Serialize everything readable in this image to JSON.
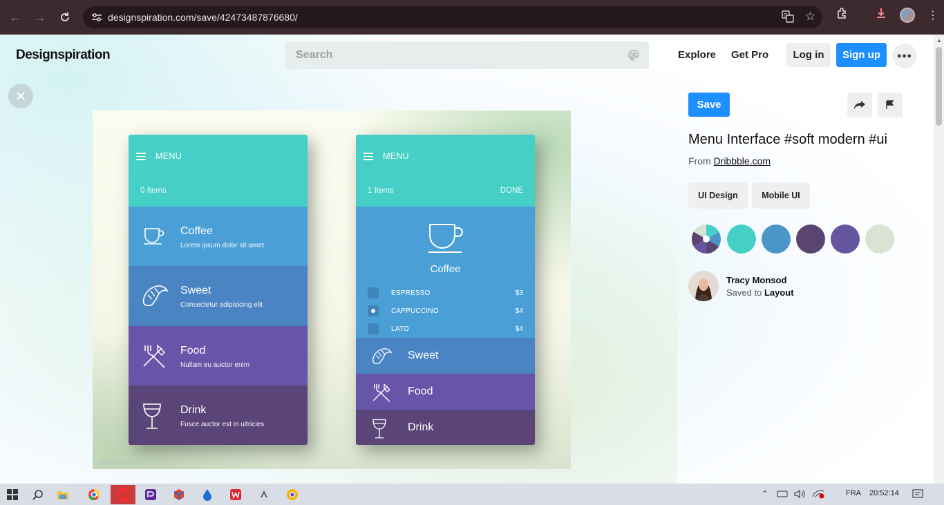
{
  "browser": {
    "url": "designspiration.com/save/42473487876680/"
  },
  "site": {
    "brand": "Designspiration",
    "search_placeholder": "Search",
    "nav": {
      "explore": "Explore",
      "get_pro": "Get Pro"
    },
    "login": "Log in",
    "signup": "Sign up",
    "more": "•••"
  },
  "artwork": {
    "credit": "dribbble.com/galshir",
    "left_phone": {
      "menu": "MENU",
      "count": "0 Items",
      "categories": [
        {
          "title": "Coffee",
          "subtitle": "Lorem ipsum dolor sit amet"
        },
        {
          "title": "Sweet",
          "subtitle": "Consectetur adipisicing elit"
        },
        {
          "title": "Food",
          "subtitle": "Nullam eu auctor enim"
        },
        {
          "title": "Drink",
          "subtitle": "Fusce auctor est in ultricies"
        }
      ]
    },
    "right_phone": {
      "menu": "MENU",
      "count": "1 Items",
      "done": "DONE",
      "expanded_title": "Coffee",
      "options": [
        {
          "name": "ESPRESSO",
          "price": "$3",
          "checked": false
        },
        {
          "name": "CAPPUCCINO",
          "price": "$4",
          "checked": true
        },
        {
          "name": "LATO",
          "price": "$4",
          "checked": false
        }
      ],
      "categories": [
        {
          "title": "Sweet"
        },
        {
          "title": "Food"
        },
        {
          "title": "Drink"
        }
      ]
    }
  },
  "sidebar": {
    "save": "Save",
    "title": "Menu Interface #soft modern #ui",
    "from_label": "From",
    "source": "Dribbble.com",
    "tags": [
      "UI Design",
      "Mobile UI"
    ],
    "colors": [
      "#45cfc6",
      "#4a96c8",
      "#5a4470",
      "#6656a0",
      "#d8e3d3"
    ],
    "user": {
      "name": "Tracy Monsod",
      "saved_to_label": "Saved to",
      "board": "Layout"
    }
  },
  "taskbar": {
    "lang": "FRA",
    "time": "20:52:14"
  }
}
